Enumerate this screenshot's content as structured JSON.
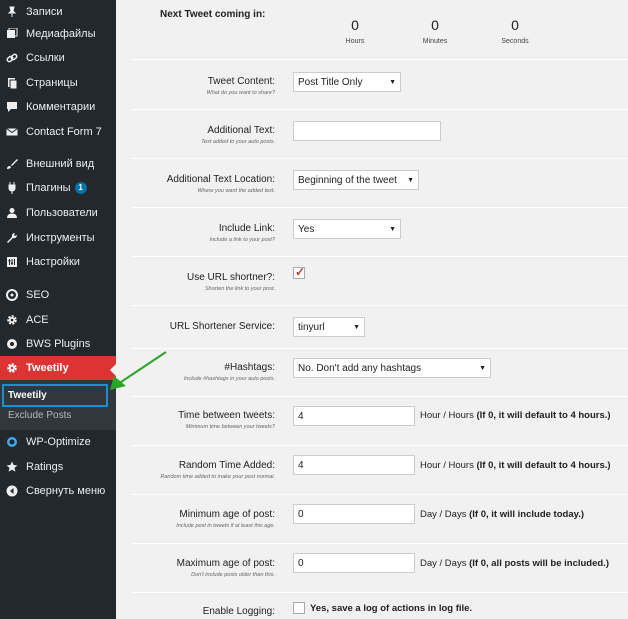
{
  "sidebar": {
    "items": [
      {
        "label": "Записи",
        "icon": "pin-icon"
      },
      {
        "label": "Медиафайлы",
        "icon": "media-icon"
      },
      {
        "label": "Ссылки",
        "icon": "link-icon"
      },
      {
        "label": "Страницы",
        "icon": "page-icon"
      },
      {
        "label": "Комментарии",
        "icon": "comment-icon"
      },
      {
        "label": "Contact Form 7",
        "icon": "mail-icon"
      },
      {
        "label": "Внешний вид",
        "icon": "brush-icon"
      },
      {
        "label": "Плагины",
        "icon": "plugin-icon",
        "badge": "1"
      },
      {
        "label": "Пользователи",
        "icon": "user-icon"
      },
      {
        "label": "Инструменты",
        "icon": "wrench-icon"
      },
      {
        "label": "Настройки",
        "icon": "settings-icon"
      },
      {
        "label": "SEO",
        "icon": "seo-icon"
      },
      {
        "label": "ACE",
        "icon": "gear-icon"
      },
      {
        "label": "BWS Plugins",
        "icon": "bws-icon"
      },
      {
        "label": "Tweetily",
        "icon": "gear-icon"
      },
      {
        "label": "WP-Optimize",
        "icon": "wp-optimize-icon"
      },
      {
        "label": "Ratings",
        "icon": "star-icon"
      },
      {
        "label": "Свернуть меню",
        "icon": "collapse-icon"
      }
    ],
    "submenu": {
      "current": "Tweetily",
      "other": "Exclude Posts"
    }
  },
  "countdown": {
    "title": "Next Tweet coming in:",
    "hours": "0",
    "minutes": "0",
    "seconds": "0",
    "hours_label": "Hours",
    "minutes_label": "Minutes",
    "seconds_label": "Seconds"
  },
  "form": {
    "tweet_content": {
      "label": "Tweet Content:",
      "hint": "What do you want to share?",
      "value": "Post Title Only"
    },
    "additional_text": {
      "label": "Additional Text:",
      "hint": "Text added to your auto posts.",
      "value": ""
    },
    "additional_text_location": {
      "label": "Additional Text Location:",
      "hint": "Where you want the added text.",
      "value": "Beginning of the tweet"
    },
    "include_link": {
      "label": "Include Link:",
      "hint": "Include a link to your post?",
      "value": "Yes"
    },
    "use_url_shortner": {
      "label": "Use URL shortner?:",
      "hint": "Shorten the link to your post.",
      "checked": true
    },
    "url_shortener_service": {
      "label": "URL Shortener Service:",
      "hint": "",
      "value": "tinyurl"
    },
    "hashtags": {
      "label": "#Hashtags:",
      "hint": "Include #hashtags in your auto posts.",
      "value": "No. Don't add any hashtags"
    },
    "time_between": {
      "label": "Time between tweets:",
      "hint": "Minimum time between your tweets?",
      "value": "4",
      "after_plain": "Hour / Hours ",
      "after_bold": "(If 0, it will default to 4 hours.)"
    },
    "random_time": {
      "label": "Random Time Added:",
      "hint": "Random time added to make your post normal.",
      "value": "4",
      "after_plain": "Hour / Hours ",
      "after_bold": "(If 0, it will default to 4 hours.)"
    },
    "min_age": {
      "label": "Minimum age of post:",
      "hint": "Include post in tweets if at least this age.",
      "value": "0",
      "after_plain": "Day / Days ",
      "after_bold": "(If 0, it will include today.)"
    },
    "max_age": {
      "label": "Maximum age of post:",
      "hint": "Don't include posts older than this.",
      "value": "0",
      "after_plain": "Day / Days ",
      "after_bold": "(If 0, all posts will be included.)"
    },
    "enable_logging": {
      "label": "Enable Logging:",
      "hint": "",
      "checked": false,
      "checkbox_label": "Yes, save a log of actions in log file."
    }
  },
  "colors": {
    "sidebar_bg": "#23282d",
    "active_item": "#dd3333",
    "highlight_box": "#1a8fd9",
    "annotation_arrow": "#2aa52a"
  }
}
